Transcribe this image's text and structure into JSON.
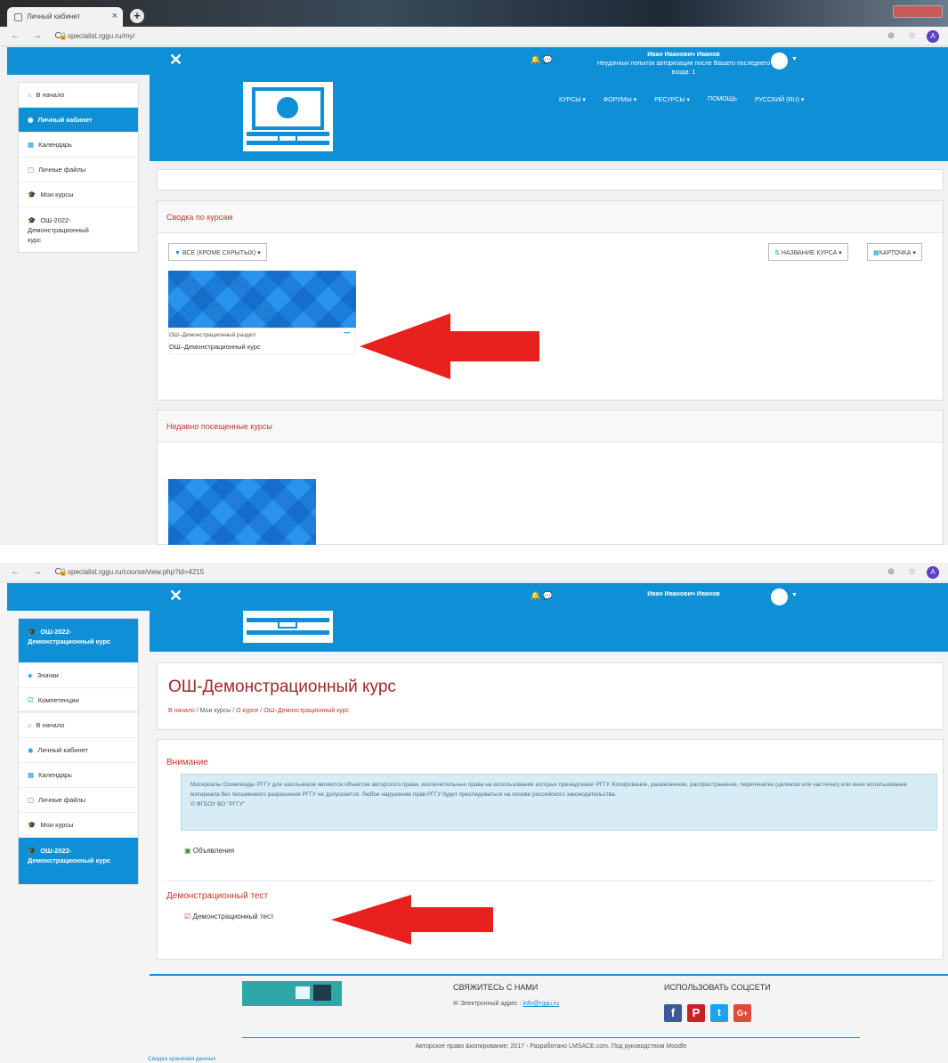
{
  "browser1": {
    "tab_title": "Личный кабинет",
    "url": "specialist.rggu.ru/my/"
  },
  "browser2": {
    "url": "specialist.rggu.ru/course/view.php?id=4215"
  },
  "navbar": {
    "close": "✕",
    "user_name": "Иван Иванович Иванов",
    "failed_logins": "Неудачных попыток авторизации после Вашего последнего входа: 1"
  },
  "topmenu": [
    "КУРСЫ ▾",
    "ФОРУМЫ ▾",
    "РЕСУРСЫ ▾",
    "ПОМОЩЬ",
    "РУССКИЙ (RU) ▾"
  ],
  "sidebar1": [
    {
      "label": "В начало",
      "icon": "home-icon"
    },
    {
      "label": "Личный кабинет",
      "icon": "dashboard-icon",
      "active": true
    },
    {
      "label": "Календарь",
      "icon": "calendar-icon"
    },
    {
      "label": "Личные файлы",
      "icon": "file-icon"
    },
    {
      "label": "Мои курсы",
      "icon": "graduation-cap-icon"
    },
    {
      "label": "ОШ-2022-Демонстрационный курс",
      "icon": "graduation-cap-icon"
    }
  ],
  "overview": {
    "title": "Сводка по курсам",
    "filter": "ВСЕ (КРОМЕ СКРЫТЫХ) ▾",
    "sort": "НАЗВАНИЕ КУРСА ▾",
    "view": "КАРТОЧКА ▾",
    "course_category": "ОШ–Демонстрационный раздел",
    "course_name": "ОШ–Демонстрационный курс",
    "more": "•••"
  },
  "recent": {
    "title": "Недавно посещенные курсы"
  },
  "sidebar2": [
    {
      "label": "ОШ-2022-Демонстрационный курс",
      "icon": "graduation-cap-icon",
      "active": true
    },
    {
      "label": "Значки",
      "icon": "badge-icon"
    },
    {
      "label": "Компетенции",
      "icon": "checkbox-icon"
    },
    {
      "label": "В начало",
      "icon": "home-icon"
    },
    {
      "label": "Личный кабинет",
      "icon": "dashboard-icon"
    },
    {
      "label": "Календарь",
      "icon": "calendar-icon"
    },
    {
      "label": "Личные файлы",
      "icon": "file-icon"
    },
    {
      "label": "Мои курсы",
      "icon": "graduation-cap-icon"
    },
    {
      "label": "ОШ-2022-Демонстрационный курс",
      "icon": "graduation-cap-icon",
      "active": true
    }
  ],
  "course": {
    "title": "ОШ-Демонстрационный курс",
    "breadcrumb": [
      "В начало",
      "Мои курсы",
      "О курсе",
      "ОШ–Демонстрационный курс"
    ],
    "attention_title": "Внимание",
    "attention_text": "Материалы Олимпиады РГГУ для школьников являются объектом авторского права, исключительные права на использование которых принадлежат РГГУ. Копирование, размножение, распространение, перепечатка (целиком или частично) или иное использование материала без письменного разрешения РГГУ не допускается. Любое нарушение прав РГГУ будет преследоваться на основе российского законодательства.",
    "copyright": "© ФГБОУ ВО \"РГГУ\"",
    "announcements": "Объявления",
    "section_title": "Демонстрационный тест",
    "quiz": "Демонстрационный тест"
  },
  "footer": {
    "contact_title": "СВЯЖИТЕСЬ С НАМИ",
    "email_label": "Электронный адрес :",
    "email": "info@rggu.ru",
    "social_title": "ИСПОЛЬЗОВАТЬ СОЦСЕТИ",
    "copyright": "Авторское право &копирование; 2017 - Разработано LMSACE.com. Под руководством Moodle",
    "retention": "Сводка хранения данных"
  },
  "colors": {
    "brand": "#0e8fd6",
    "accent_red": "#c0392b",
    "arrow": "#e8201e"
  }
}
